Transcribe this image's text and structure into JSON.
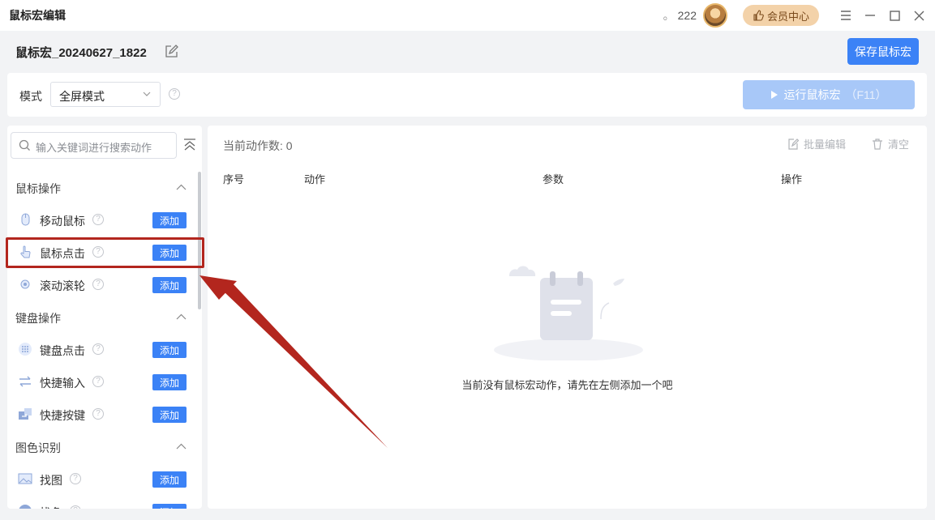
{
  "window": {
    "title": "鼠标宏编辑",
    "points": "222",
    "vip_label": "会员中心"
  },
  "header": {
    "macro_name": "鼠标宏_20240627_1822",
    "save_label": "保存鼠标宏"
  },
  "mode": {
    "label": "模式",
    "selected": "全屏模式",
    "run_label": "运行鼠标宏",
    "run_hotkey": "（F11）"
  },
  "sidebar": {
    "search_placeholder": "输入关键词进行搜索动作",
    "add_label": "添加",
    "categories": [
      {
        "label": "鼠标操作",
        "items": [
          "移动鼠标",
          "鼠标点击",
          "滚动滚轮"
        ]
      },
      {
        "label": "键盘操作",
        "items": [
          "键盘点击",
          "快捷输入",
          "快捷按键"
        ]
      },
      {
        "label": "图色识别",
        "items": [
          "找图",
          "找色"
        ]
      }
    ]
  },
  "main": {
    "count_label": "当前动作数: 0",
    "bulk_edit": "批量编辑",
    "clear": "清空",
    "columns": [
      "序号",
      "动作",
      "参数",
      "操作"
    ],
    "empty_text": "当前没有鼠标宏动作，请先在左侧添加一个吧"
  },
  "colors": {
    "accent": "#3b82f6",
    "accent_disabled": "#a8c8f8",
    "highlight": "#b3261e",
    "vip_bg": "#f3d2a9"
  }
}
